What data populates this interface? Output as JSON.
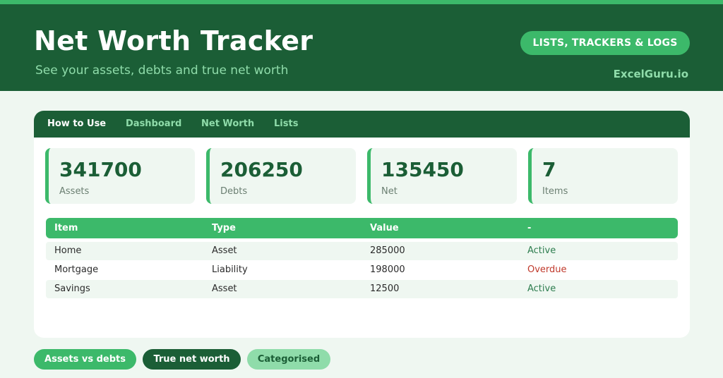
{
  "header": {
    "title": "Net Worth Tracker",
    "subtitle": "See your assets, debts and true net worth",
    "pill_label": "LISTS, TRACKERS & LOGS",
    "brand": "ExcelGuru.io"
  },
  "nav": {
    "tabs": [
      "How to Use",
      "Dashboard",
      "Net Worth",
      "Lists"
    ],
    "active": "How to Use"
  },
  "stats": [
    {
      "value": "341700",
      "label": "Assets"
    },
    {
      "value": "206250",
      "label": "Debts"
    },
    {
      "value": "135450",
      "label": "Net"
    },
    {
      "value": "7",
      "label": "Items"
    }
  ],
  "table": {
    "columns": [
      "Item",
      "Type",
      "Value",
      "-"
    ],
    "rows": [
      {
        "item": "Home",
        "type": "Asset",
        "value": "285000",
        "status": "Active"
      },
      {
        "item": "Mortgage",
        "type": "Liability",
        "value": "198000",
        "status": "Overdue"
      },
      {
        "item": "Savings",
        "type": "Asset",
        "value": "12500",
        "status": "Active"
      }
    ]
  },
  "chips": [
    "Assets vs debts",
    "True net worth",
    "Categorised"
  ],
  "colors": {
    "header_bg": "#1b5e36",
    "accent": "#3cb96a",
    "light_accent": "#8fdcaa",
    "page_bg": "#eff7f1",
    "status_active": "#2e7d4f",
    "status_overdue": "#c0392b"
  }
}
